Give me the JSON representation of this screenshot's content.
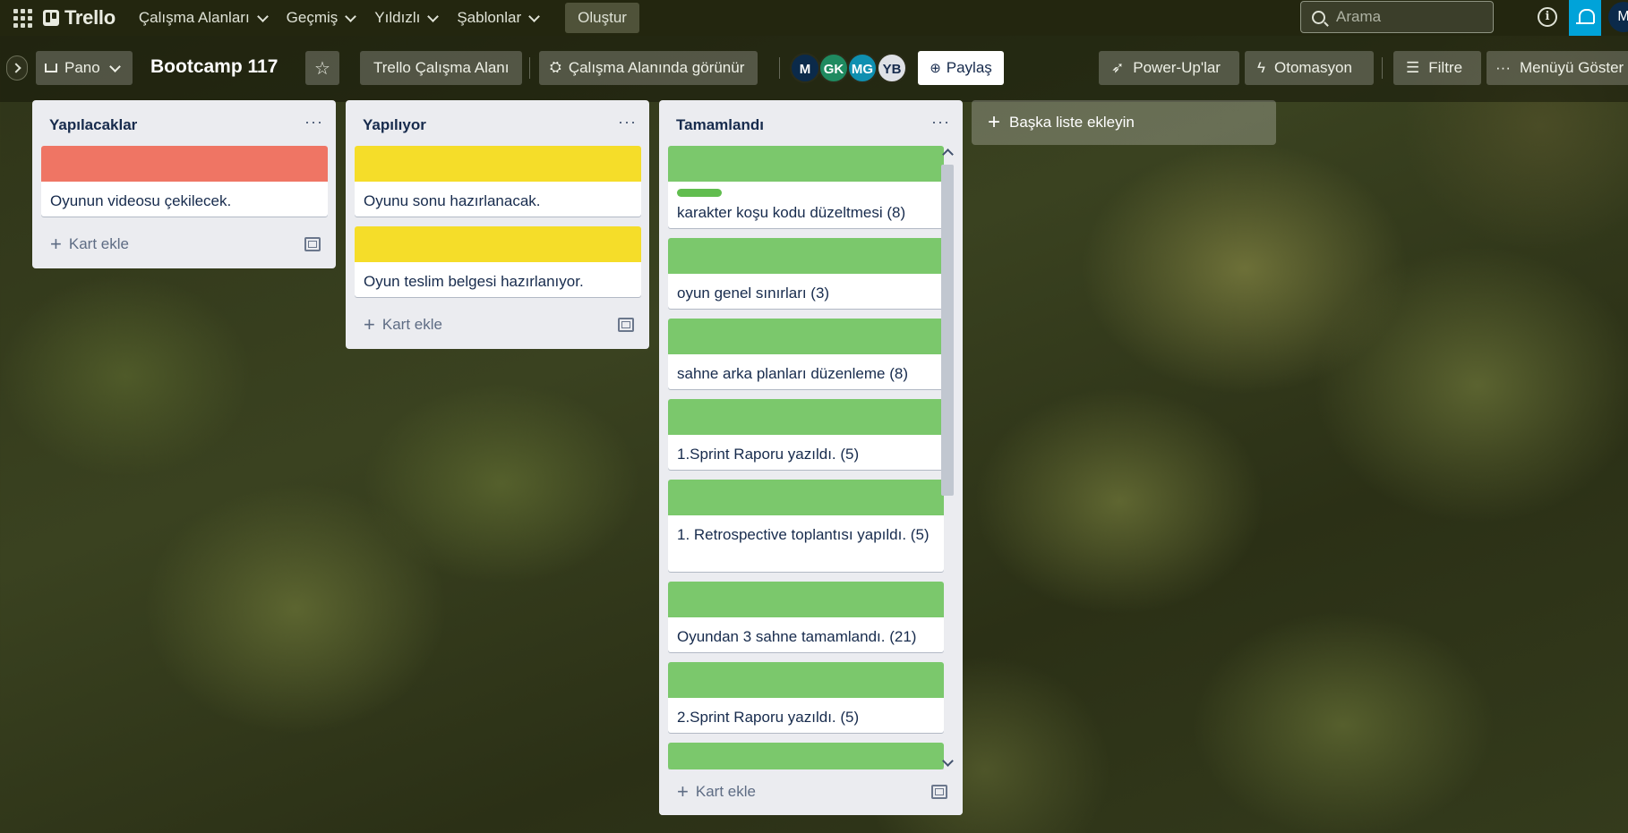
{
  "header": {
    "brand": "Trello",
    "nav": [
      "Çalışma Alanları",
      "Geçmiş",
      "Yıldızlı",
      "Şablonlar"
    ],
    "create_label": "Oluştur",
    "search_placeholder": "Arama",
    "user_avatar": "M"
  },
  "boardbar": {
    "view_label": "Pano",
    "board_title": "Bootcamp 117",
    "workspace_label": "Trello Çalışma Alanı",
    "visibility_label": "Çalışma Alanında görünür",
    "members": [
      {
        "initials": "M",
        "color": "#0b2a4a"
      },
      {
        "initials": "GK",
        "color": "#1f8a60"
      },
      {
        "initials": "MG",
        "color": "#0f8fb0"
      },
      {
        "initials": "YB",
        "color": "#dfe1e6"
      }
    ],
    "share_label": "Paylaş",
    "powerups_label": "Power-Up'lar",
    "automation_label": "Otomasyon",
    "filter_label": "Filtre",
    "menu_label": "Menüyü Göster"
  },
  "lists": [
    {
      "title": "Yapılacaklar",
      "add_card": "Kart ekle",
      "cards": [
        {
          "text": "Oyunun videosu çekilecek.",
          "cover": "#ef7564"
        }
      ]
    },
    {
      "title": "Yapılıyor",
      "add_card": "Kart ekle",
      "cards": [
        {
          "text": "Oyunu sonu hazırlanacak.",
          "cover": "#f5dd29"
        },
        {
          "text": "Oyun teslim belgesi hazırlanıyor.",
          "cover": "#f5dd29"
        }
      ]
    },
    {
      "title": "Tamamlandı",
      "add_card": "Kart ekle",
      "cards": [
        {
          "text": "karakter koşu kodu düzeltmesi (8)",
          "cover": "#7bc86c"
        },
        {
          "text": "oyun genel sınırları (3)",
          "cover": "#7bc86c"
        },
        {
          "text": "sahne arka planları düzenleme (8)",
          "cover": "#7bc86c"
        },
        {
          "text": "1.Sprint Raporu yazıldı. (5)",
          "cover": "#7bc86c"
        },
        {
          "text": "1. Retrospective toplantısı yapıldı. (5)",
          "cover": "#7bc86c"
        },
        {
          "text": "Oyundan 3 sahne tamamlandı. (21)",
          "cover": "#7bc86c"
        },
        {
          "text": "2.Sprint Raporu yazıldı. (5)",
          "cover": "#7bc86c"
        }
      ]
    }
  ],
  "add_list_label": "Başka liste ekleyin"
}
